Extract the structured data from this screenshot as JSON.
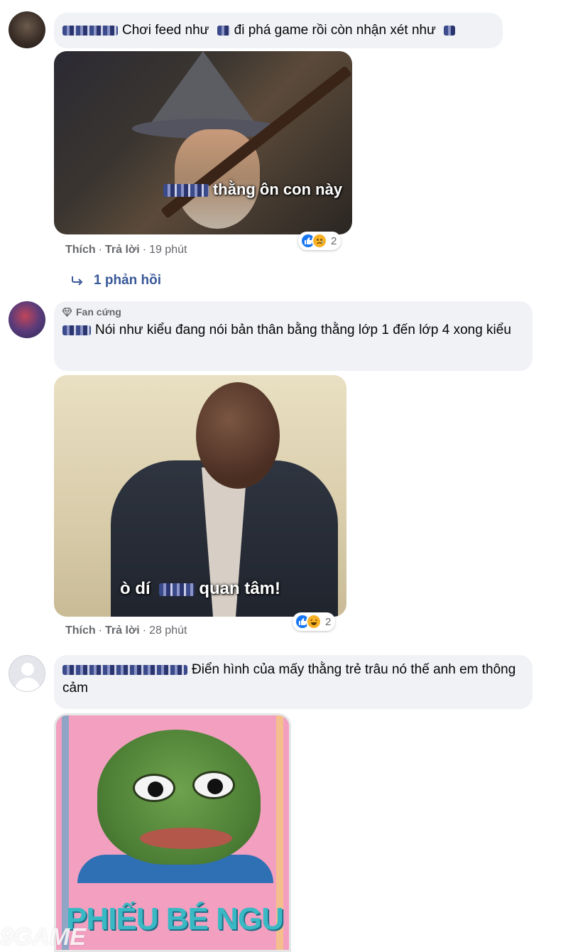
{
  "comments": [
    {
      "text": "Chơi feed như",
      "text_b": "đi phá game rồi còn nhận xét như",
      "media_caption": "thằng ôn con này",
      "actions": {
        "like": "Thích",
        "reply": "Trả lời",
        "time": "19 phút"
      },
      "reactions": {
        "types": [
          "like",
          "sad"
        ],
        "count": "2"
      },
      "replies_label": "1 phản hồi"
    },
    {
      "badge": "Fan cứng",
      "text": "Nói như kiểu đang nói bản thân bằng thằng lớp 1 đến lớp 4 xong kiểu",
      "media_caption_a": "ò dí",
      "media_caption_b": "quan tâm!",
      "actions": {
        "like": "Thích",
        "reply": "Trả lời",
        "time": "28 phút"
      },
      "reactions": {
        "types": [
          "like",
          "haha"
        ],
        "count": "2"
      }
    },
    {
      "text": "Điển hình của mấy thằng trẻ trâu nó thế anh em thông cảm",
      "media_caption": "PHIẾU BÉ NGU"
    }
  ],
  "watermark": "9GAME",
  "colors": {
    "bubble": "#f0f2f5",
    "link": "#385898",
    "meta": "#65676b",
    "like": "#1877f2",
    "emoji": "#f7b125"
  }
}
